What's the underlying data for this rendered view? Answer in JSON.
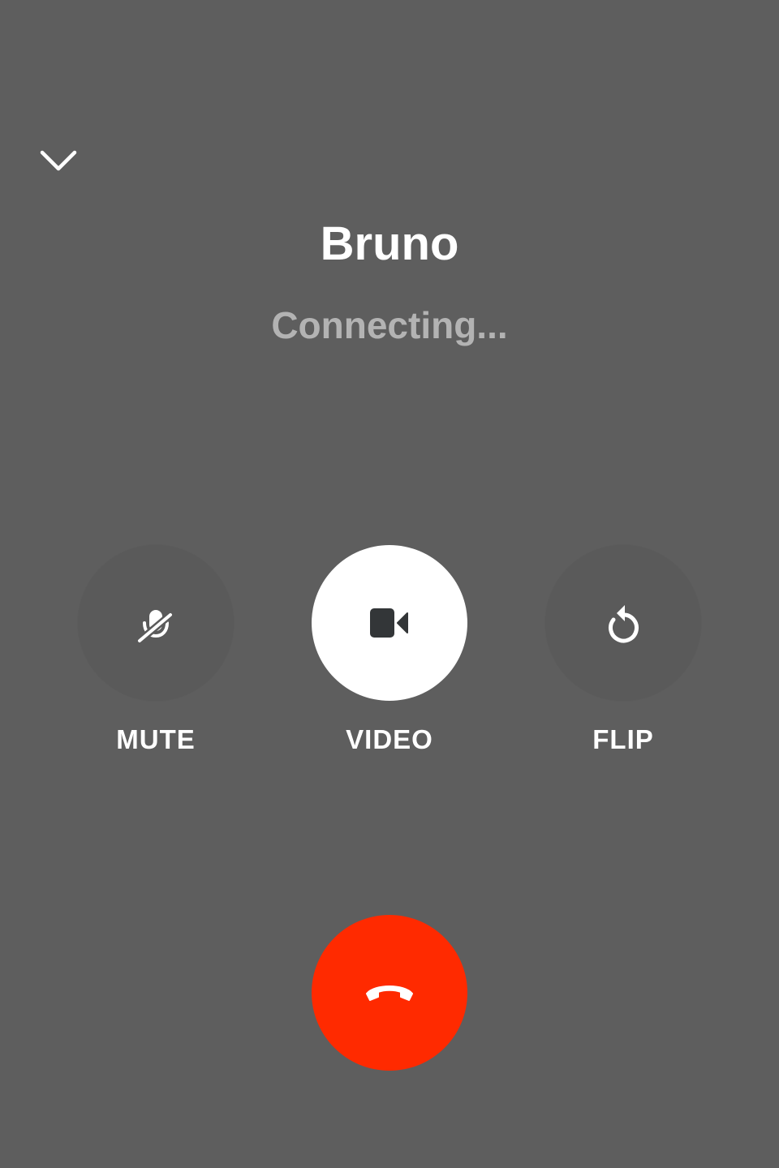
{
  "header": {
    "collapse_icon": "chevron-down-icon"
  },
  "call": {
    "caller_name": "Bruno",
    "status": "Connecting..."
  },
  "controls": [
    {
      "label": "MUTE",
      "icon": "mic-off-icon",
      "active": false
    },
    {
      "label": "VIDEO",
      "icon": "video-camera-icon",
      "active": true
    },
    {
      "label": "FLIP",
      "icon": "flip-camera-icon",
      "active": false
    }
  ],
  "end_call": {
    "icon": "hang-up-icon",
    "color": "#ff2a00"
  },
  "colors": {
    "background": "#5e5e5e",
    "status_text": "#b3b3b3",
    "active_button": "#ffffff",
    "icon_dark": "#333638"
  }
}
